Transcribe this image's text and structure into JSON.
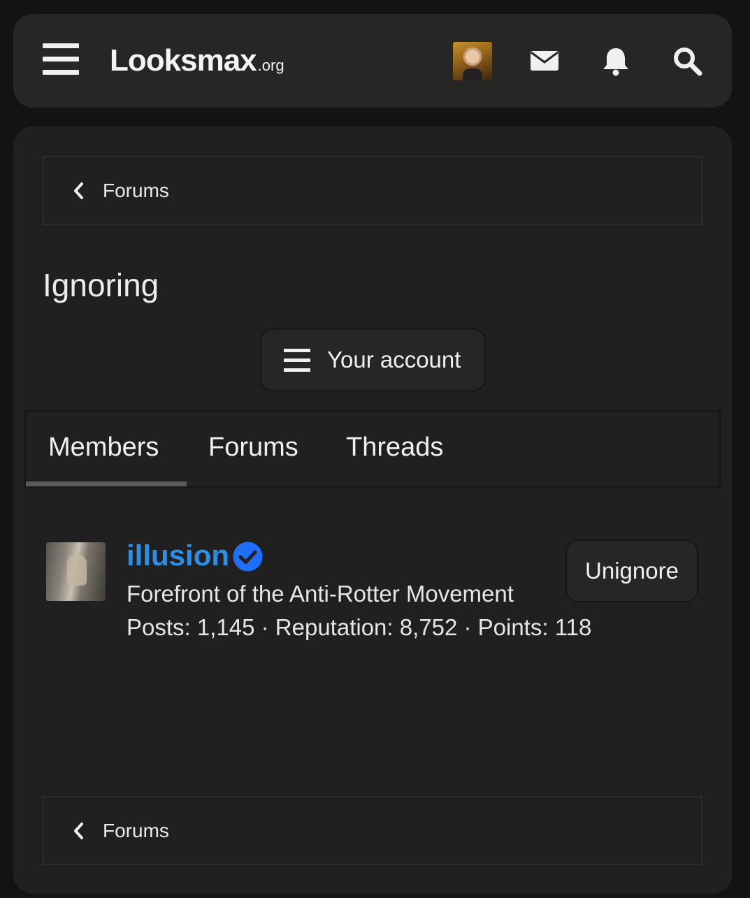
{
  "header": {
    "logo_main": "Looksmax",
    "logo_tld": ".org",
    "icons": [
      "menu-icon",
      "avatar",
      "mail-icon",
      "bell-icon",
      "search-icon"
    ]
  },
  "breadcrumb_top": {
    "label": "Forums"
  },
  "page": {
    "title": "Ignoring"
  },
  "account_button": {
    "label": "Your account"
  },
  "tabs": [
    {
      "label": "Members",
      "active": true
    },
    {
      "label": "Forums",
      "active": false
    },
    {
      "label": "Threads",
      "active": false
    }
  ],
  "members": [
    {
      "name": "illusion",
      "verified": true,
      "title": "Forefront of the Anti-Rotter Movement",
      "stats": "Posts: 1,145 · Reputation: 8,752 · Points: 118",
      "action_label": "Unignore"
    }
  ],
  "breadcrumb_bottom": {
    "label": "Forums"
  },
  "colors": {
    "background": "#131313",
    "panel": "#202020",
    "header": "#262626",
    "username": "#2d8ee6",
    "verified_badge": "#1f6fff"
  }
}
